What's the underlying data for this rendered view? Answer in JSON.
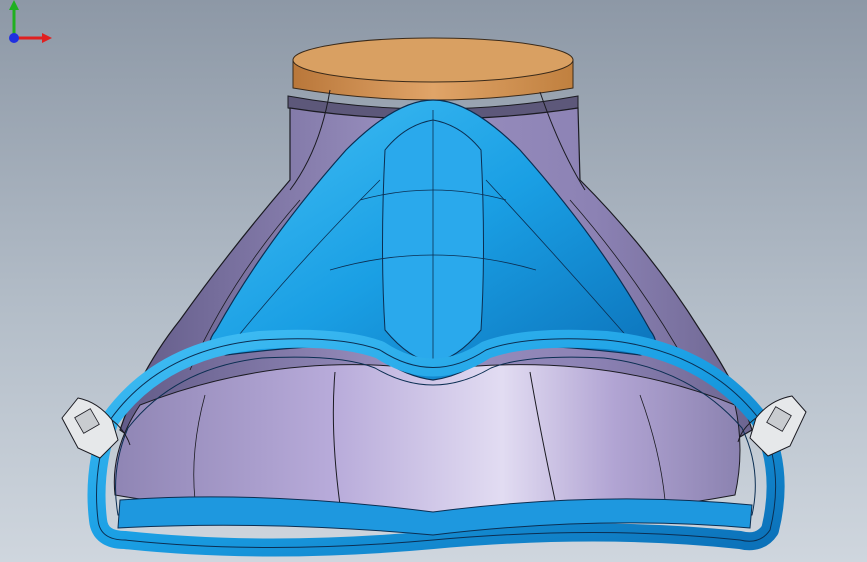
{
  "app": {
    "view": "graphics-area"
  },
  "model": {
    "part": "mask-body",
    "colors": {
      "cap": "#c98f4e",
      "cap_top": "#d7a064",
      "shell": "#8f86b2",
      "shell_dark": "#5f5a82",
      "interior": "#b3a6d6",
      "seal": "#1aa3e8",
      "seal_dark": "#0b6fb5",
      "clip": "#e6e8ea",
      "edges": "#1b1b22"
    }
  },
  "triad": {
    "axes": [
      "x",
      "y",
      "z"
    ],
    "colors": {
      "x": "#e02020",
      "y": "#20b020",
      "z": "#2030e0"
    }
  }
}
